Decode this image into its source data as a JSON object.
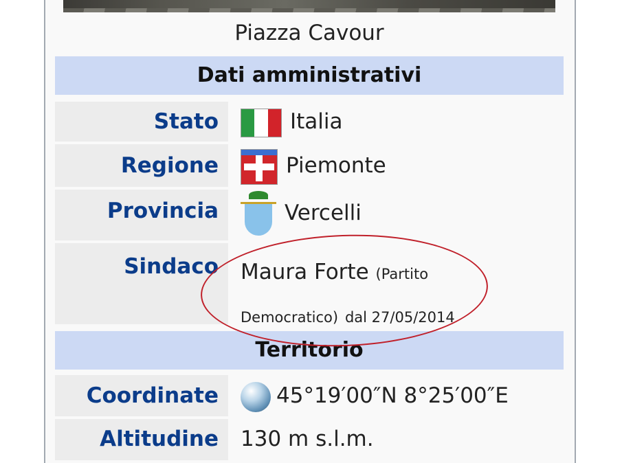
{
  "caption": "Piazza Cavour",
  "sections": {
    "admin": "Dati amministrativi",
    "territory": "Territorio"
  },
  "rows": {
    "stato": {
      "label": "Stato",
      "value": "Italia"
    },
    "regione": {
      "label": "Regione",
      "value": "Piemonte"
    },
    "provincia": {
      "label": "Provincia",
      "value": "Vercelli"
    },
    "sindaco": {
      "label": "Sindaco",
      "name": "Maura Forte",
      "party_open": "(Partito",
      "party_close": "Democratico)",
      "since": "dal 27/05/2014"
    },
    "coordinate": {
      "label": "Coordinate",
      "value": "45°19′00″N 8°25′00″E"
    },
    "altitudine": {
      "label": "Altitudine",
      "value": "130 m s.l.m."
    }
  },
  "icons": {
    "stato": "italy-flag-icon",
    "regione": "piemonte-flag-icon",
    "provincia": "vercelli-coat-of-arms-icon",
    "coordinate": "globe-icon"
  },
  "colors": {
    "section_header": "#ccd9f4",
    "label_text": "#0b3c8a",
    "annotation": "#c0202a"
  }
}
